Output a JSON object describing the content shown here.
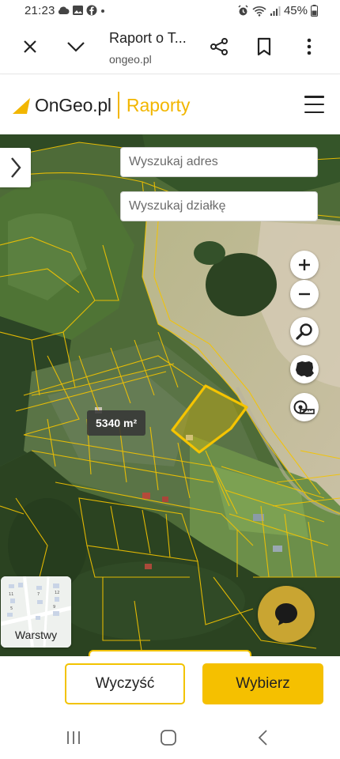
{
  "status_bar": {
    "time": "21:23",
    "battery": "45%",
    "icons_left": [
      "cloud-icon",
      "image-icon",
      "facebook-icon",
      "dot-icon"
    ],
    "icons_right": [
      "alarm-icon",
      "wifi-icon",
      "signal-icon",
      "battery-icon"
    ]
  },
  "browser": {
    "tab_title": "Raport o T...",
    "url": "ongeo.pl",
    "buttons": [
      "close-icon",
      "chevron-down-icon",
      "share-icon",
      "bookmark-icon",
      "more-vertical-icon"
    ]
  },
  "site_header": {
    "brand": "OnGeo.pl",
    "section": "Raporty",
    "accent_color": "#f2b600"
  },
  "map": {
    "search_address_placeholder": "Wyszukaj adres",
    "search_parcel_placeholder": "Wyszukaj działkę",
    "area_label": "5340 m²",
    "layers_label": "Warstwy",
    "controls": [
      "zoom-in-icon",
      "zoom-out-icon",
      "magnifier-icon",
      "poland-map-icon",
      "measure-tape-icon"
    ],
    "parcel_outline_color": "#f5c400",
    "selected_parcel_color": "#e8c000"
  },
  "actions": {
    "clear_label": "Wyczyść",
    "choose_label": "Wybierz",
    "primary_color": "#f5c000"
  },
  "nav_bar": {
    "buttons": [
      "recent-apps-icon",
      "home-icon",
      "back-icon"
    ]
  }
}
